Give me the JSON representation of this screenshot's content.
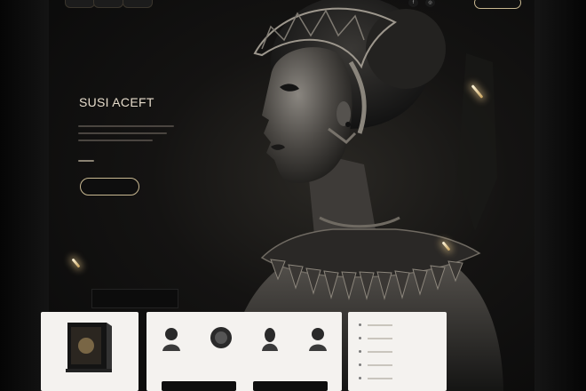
{
  "nav": {
    "links": [
      "",
      "",
      ""
    ],
    "icons": [
      "fb-icon",
      "ig-icon"
    ],
    "cta": ""
  },
  "hero": {
    "title": "SUSI ACEFT",
    "meta": "",
    "button": ""
  },
  "tabs": {
    "left": "",
    "right": ""
  },
  "cards": {
    "product_caption": "",
    "avatar_labels": [
      "",
      "",
      "",
      ""
    ],
    "list_items": [
      "",
      "",
      "",
      "",
      ""
    ]
  },
  "colors": {
    "accent": "#c8b891",
    "background": "#0b0b0b",
    "panel": "#f4f2ef"
  }
}
